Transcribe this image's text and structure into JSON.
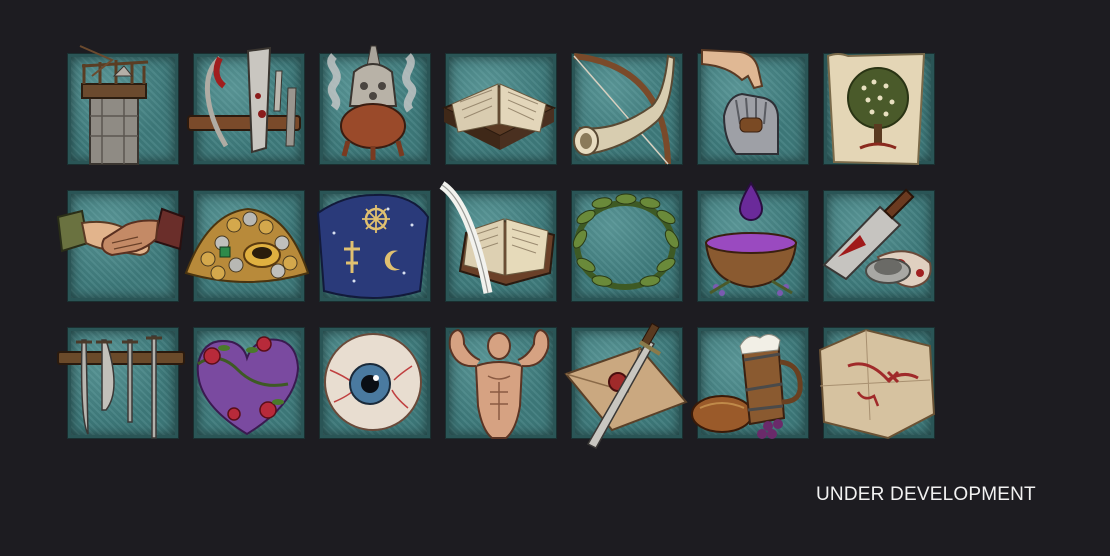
{
  "footer": {
    "status": "UNDER DEVELOPMENT"
  },
  "colors": {
    "background": "#1d1c21",
    "tile": "#3f7c7d",
    "tile_border": "#2a5556",
    "caption": "#f2f2f2"
  },
  "icons": [
    "watchtower-icon",
    "butcher-tools-icon",
    "incense-burner-icon",
    "open-book-lectern-icon",
    "horn-and-bow-icon",
    "hand-and-gauntlet-icon",
    "tree-banner-icon",
    "handshake-icon",
    "coin-hoard-icon",
    "religious-symbols-cloth-icon",
    "quill-and-book-icon",
    "laurel-wreath-icon",
    "poison-bowl-icon",
    "bloody-cleaver-icon",
    "weapon-rack-icon",
    "rose-heart-icon",
    "eyeball-icon",
    "muscular-man-icon",
    "sealed-letter-dagger-icon",
    "feast-tankard-icon",
    "marked-map-icon"
  ]
}
